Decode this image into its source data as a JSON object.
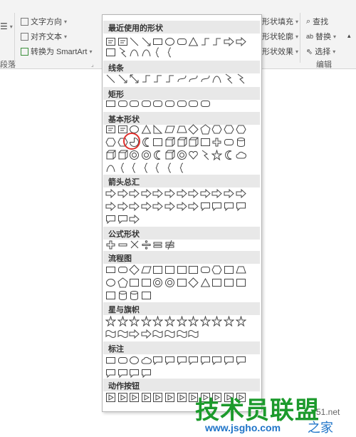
{
  "ribbon": {
    "paragraph": {
      "text_direction": "文字方向",
      "align_text": "对齐文本",
      "convert_smartart": "转换为 SmartArt",
      "group_label": "段落"
    },
    "shape_format": {
      "fill": "形状填充",
      "outline": "形状轮廓",
      "effects": "形状效果"
    },
    "editing": {
      "find": "查找",
      "replace": "替换",
      "select": "选择",
      "group_label": "编辑"
    }
  },
  "gallery": {
    "categories": [
      {
        "title": "最近使用的形状",
        "rows": [
          [
            "textbox",
            "textbox-vertical",
            "line",
            "arrow-line",
            "rectangle",
            "oval",
            "rounded-rectangle",
            "triangle",
            "elbow-connector",
            "elbow-connector-arrow",
            "right-arrow",
            "down-arrow"
          ],
          [
            "flowchart-tag",
            "lightning",
            "arc",
            "curve",
            "left-brace",
            "right-brace"
          ]
        ]
      },
      {
        "title": "线条",
        "rows": [
          [
            "line",
            "arrow-line",
            "double-arrow-line",
            "elbow-connector",
            "elbow-connector-arrow",
            "elbow-double-arrow",
            "curved-connector",
            "curved-arrow",
            "curved-double-arrow",
            "curve",
            "freeform",
            "scribble"
          ]
        ]
      },
      {
        "title": "矩形",
        "rows": [
          [
            "rectangle",
            "rounded-rectangle",
            "snip-corner",
            "snip-two",
            "snip-diag",
            "snip-round",
            "round-one",
            "round-two",
            "round-diag"
          ]
        ]
      },
      {
        "title": "基本形状",
        "rows": [
          [
            "textbox",
            "textbox-vertical",
            "oval",
            "triangle",
            "right-triangle",
            "parallelogram",
            "trapezoid",
            "diamond",
            "pentagon",
            "hexagon",
            "heptagon",
            "octagon"
          ],
          [
            "decagon",
            "dodecagon",
            "pie",
            "chord",
            "teardrop",
            "frame",
            "half-frame",
            "corner",
            "diagonal-stripe",
            "plus",
            "plaque",
            "can"
          ],
          [
            "cube",
            "bevel",
            "donut",
            "no-symbol",
            "block-arc",
            "folded-corner",
            "smiley",
            "heart",
            "lightning",
            "sun",
            "moon",
            "cloud"
          ],
          [
            "arc",
            "double-bracket",
            "double-brace",
            "left-bracket",
            "right-bracket",
            "left-brace",
            "right-brace"
          ]
        ]
      },
      {
        "title": "箭头总汇",
        "rows": [
          [
            "right-arrow",
            "left-arrow",
            "up-arrow",
            "down-arrow",
            "left-right-arrow",
            "up-down-arrow",
            "quad-arrow",
            "left-right-up-arrow",
            "bent-arrow",
            "u-turn-arrow",
            "left-up-arrow",
            "bent-up-arrow"
          ],
          [
            "curved-right-arrow",
            "curved-left-arrow",
            "curved-up-arrow",
            "curved-down-arrow",
            "striped-right-arrow",
            "notched-right-arrow",
            "pentagon-arrow",
            "chevron",
            "right-callout",
            "down-callout",
            "left-callout",
            "up-callout"
          ],
          [
            "left-right-callout",
            "quad-callout",
            "circular-arrow"
          ]
        ]
      },
      {
        "title": "公式形状",
        "rows": [
          [
            "plus",
            "minus",
            "multiply",
            "divide",
            "equal",
            "not-equal"
          ]
        ]
      },
      {
        "title": "流程图",
        "rows": [
          [
            "process",
            "alternate-process",
            "decision",
            "data",
            "predefined",
            "internal-storage",
            "document",
            "multidocument",
            "terminator",
            "preparation",
            "manual-input",
            "manual-operation"
          ],
          [
            "connector",
            "offpage",
            "card",
            "punched-tape",
            "summing-junction",
            "or",
            "collate",
            "sort",
            "extract",
            "merge",
            "stored-data",
            "delay"
          ],
          [
            "sequential-access",
            "magnetic-disk",
            "direct-access",
            "display"
          ]
        ]
      },
      {
        "title": "星与旗帜",
        "rows": [
          [
            "explosion1",
            "explosion2",
            "star4",
            "star5",
            "star6",
            "star7",
            "star8",
            "star10",
            "star12",
            "star16",
            "star24",
            "star32"
          ],
          [
            "ribbon-up",
            "ribbon-down",
            "curved-ribbon-up",
            "curved-ribbon-down",
            "vertical-scroll",
            "horizontal-scroll",
            "wave",
            "double-wave"
          ]
        ]
      },
      {
        "title": "标注",
        "rows": [
          [
            "rect-callout",
            "rounded-callout",
            "oval-callout",
            "cloud-callout",
            "line-callout1",
            "line-callout2",
            "line-callout3",
            "accent-callout1",
            "accent-callout2",
            "accent-callout3",
            "border-callout1",
            "border-callout2"
          ],
          [
            "border-callout3",
            "accent-border-callout1",
            "accent-border-callout2",
            "accent-border-callout3"
          ]
        ]
      },
      {
        "title": "动作按钮",
        "rows": [
          [
            "btn-back",
            "btn-forward",
            "btn-beginning",
            "btn-end",
            "btn-home",
            "btn-information",
            "btn-return",
            "btn-movie",
            "btn-document",
            "btn-sound",
            "btn-help",
            "btn-blank"
          ]
        ]
      }
    ],
    "highlighted_shape": "pie"
  },
  "watermark": {
    "brand": "技术员联盟",
    "site": "www.jsgho.com",
    "suffix": "之家",
    "domain": "51.net"
  },
  "colors": {
    "highlight": "#e0302d",
    "watermark_green": "#1c9a2c",
    "watermark_blue": "#1f74c8"
  }
}
